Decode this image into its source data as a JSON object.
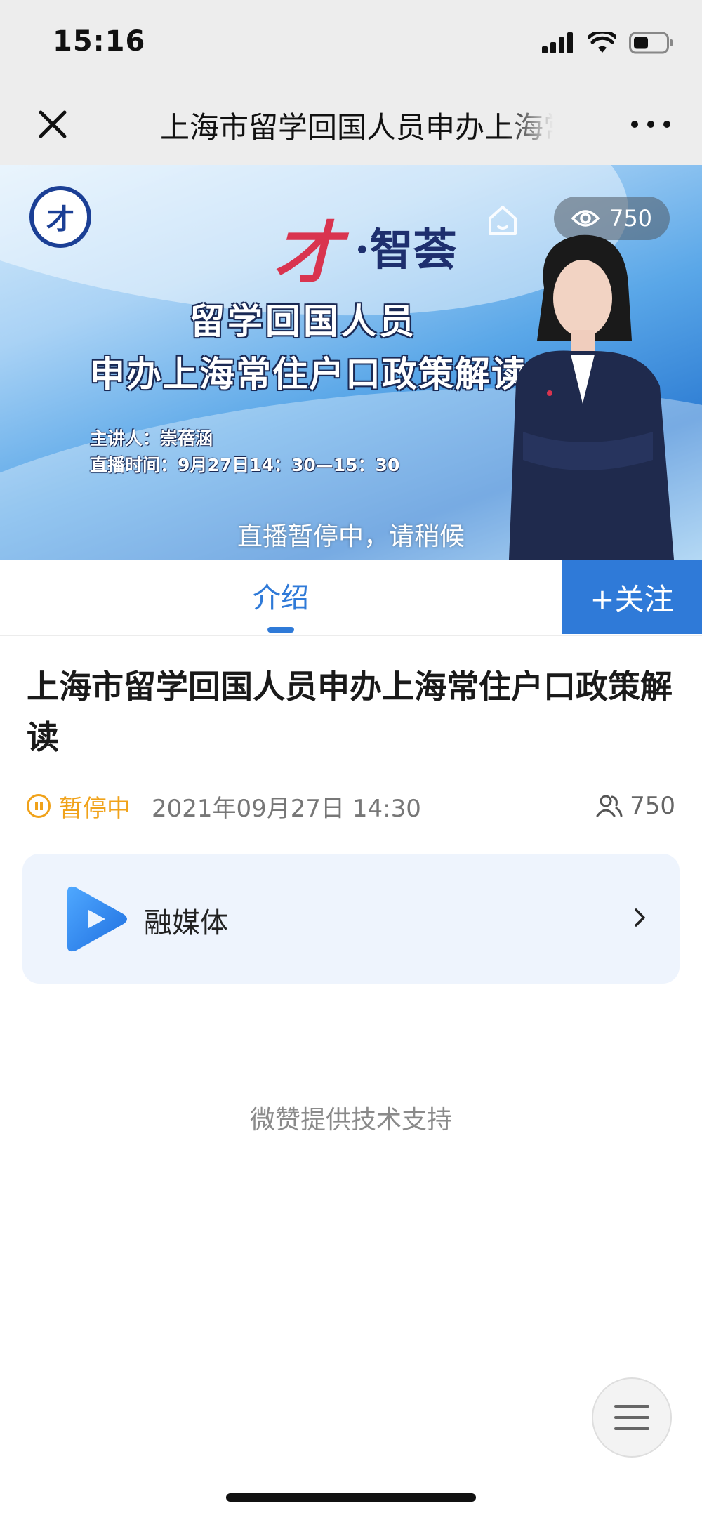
{
  "status_bar": {
    "time": "15:16"
  },
  "nav": {
    "title": "上海市留学回国人员申办上海常住户口政策解读"
  },
  "banner": {
    "brand_cai": "才",
    "brand_rest": "·智荟",
    "line1": "留学回国人员",
    "line2": "申办上海常住户口政策解读",
    "speaker": "主讲人：崇蓓涵",
    "time": "直播时间：9月27日14：30—15：30",
    "view_count": "750",
    "paused_text": "直播暂停中，请稍候"
  },
  "tabs": {
    "intro_label": "介绍",
    "follow_label": "+关注"
  },
  "article": {
    "title": "上海市留学回国人员申办上海常住户口政策解读",
    "status": "暂停中",
    "date": "2021年09月27日 14:30",
    "viewers": "750"
  },
  "channel": {
    "name": "融媒体"
  },
  "footer": {
    "credit": "微赞提供技术支持"
  },
  "colors": {
    "accent": "#2f7ad8",
    "status_paused": "#f0a21a",
    "nav_bg": "#ededed",
    "card_bg": "#eef4fd"
  },
  "icons": [
    "close-icon",
    "more-icon",
    "signal-icon",
    "wifi-icon",
    "battery-icon",
    "home-icon",
    "eye-icon",
    "pause-icon",
    "people-icon",
    "play-icon",
    "chevron-right-icon",
    "menu-icon"
  ]
}
